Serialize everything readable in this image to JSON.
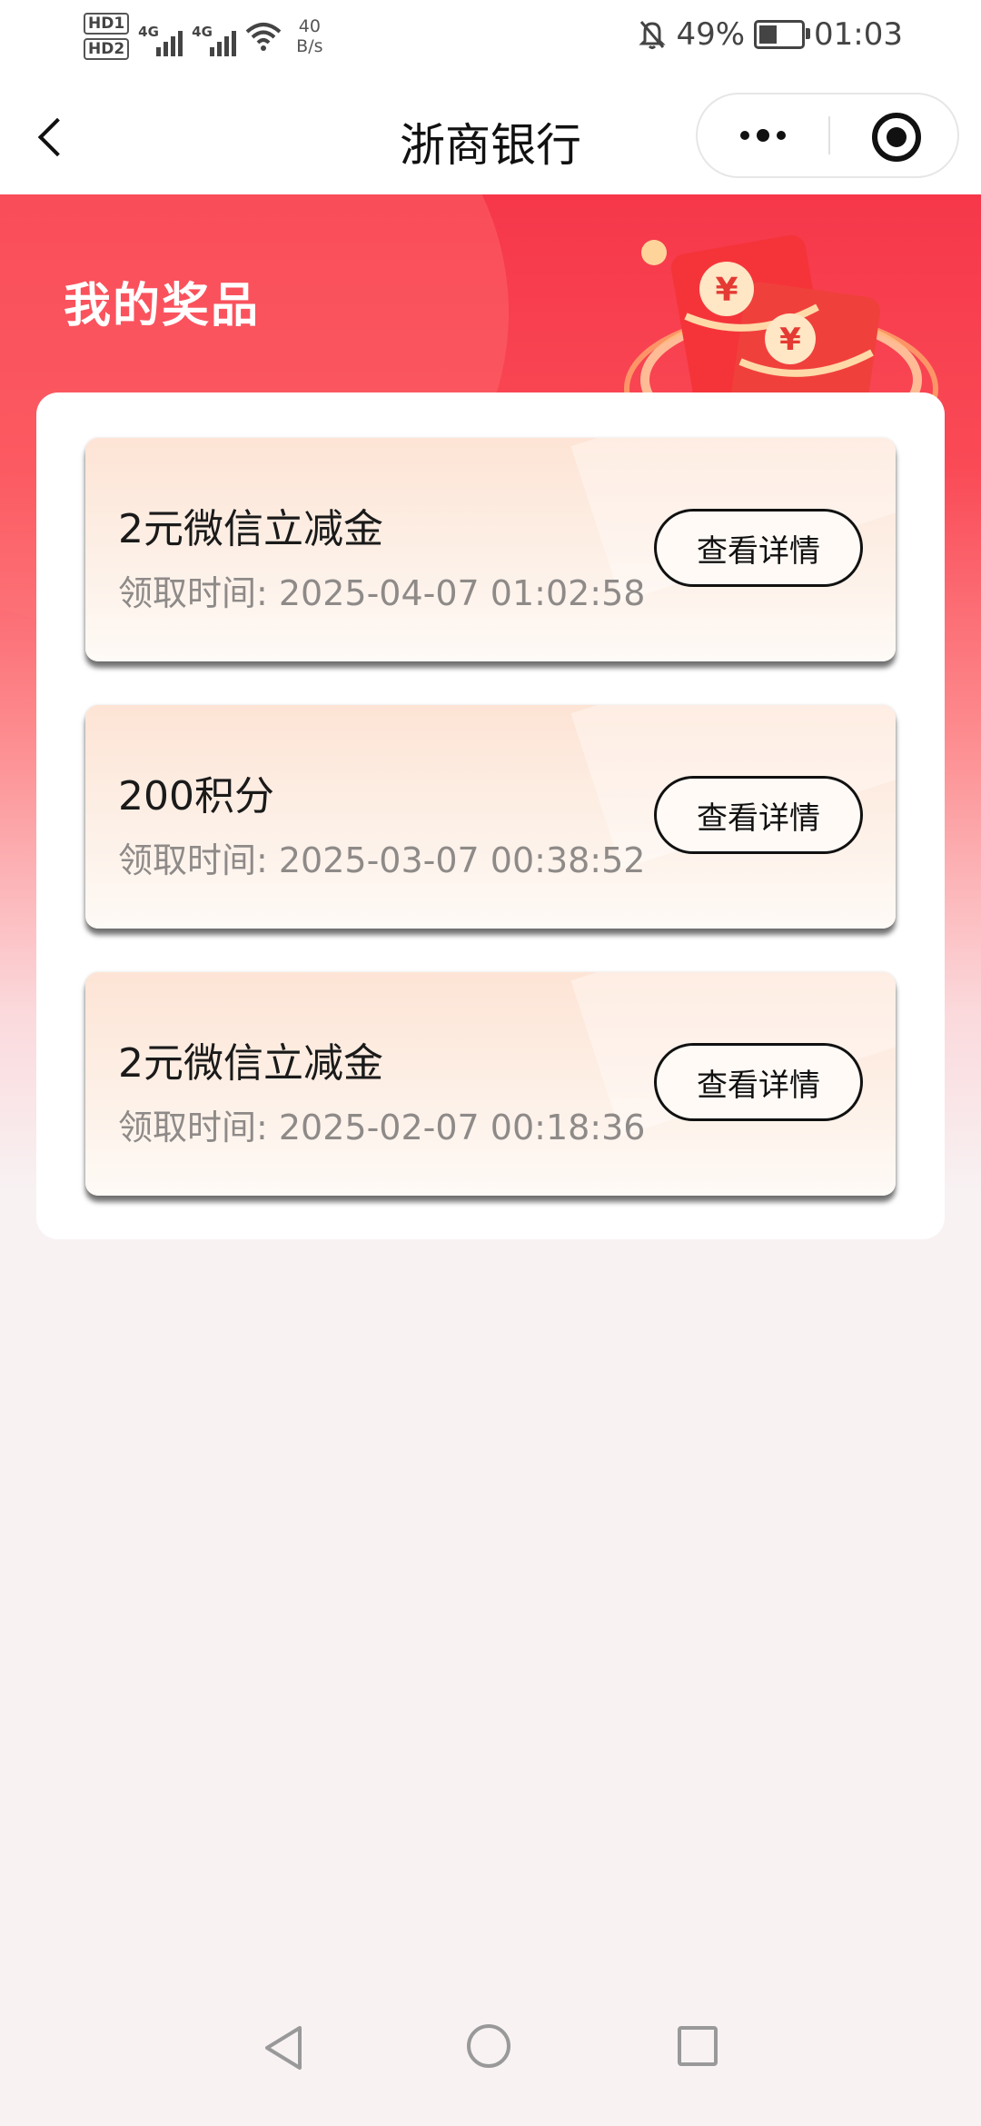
{
  "status_bar": {
    "sim1": "HD1",
    "sim2": "HD2",
    "net1": "4G",
    "net2": "4G",
    "speed_value": "40",
    "speed_unit": "B/s",
    "battery_percent": "49%",
    "battery_level": 0.49,
    "time": "01:03"
  },
  "nav": {
    "title": "浙商银行"
  },
  "banner": {
    "title": "我的奖品"
  },
  "prizes": [
    {
      "name": "2元微信立减金",
      "time": "领取时间: 2025-04-07 01:02:58",
      "button": "查看详情"
    },
    {
      "name": "200积分",
      "time": "领取时间: 2025-03-07 00:38:52",
      "button": "查看详情"
    },
    {
      "name": "2元微信立减金",
      "time": "领取时间: 2025-02-07 00:18:36",
      "button": "查看详情"
    }
  ],
  "colors": {
    "banner_red": "#f6374a",
    "card_peach": "#fde4d5",
    "background": "#f8f2f3"
  }
}
